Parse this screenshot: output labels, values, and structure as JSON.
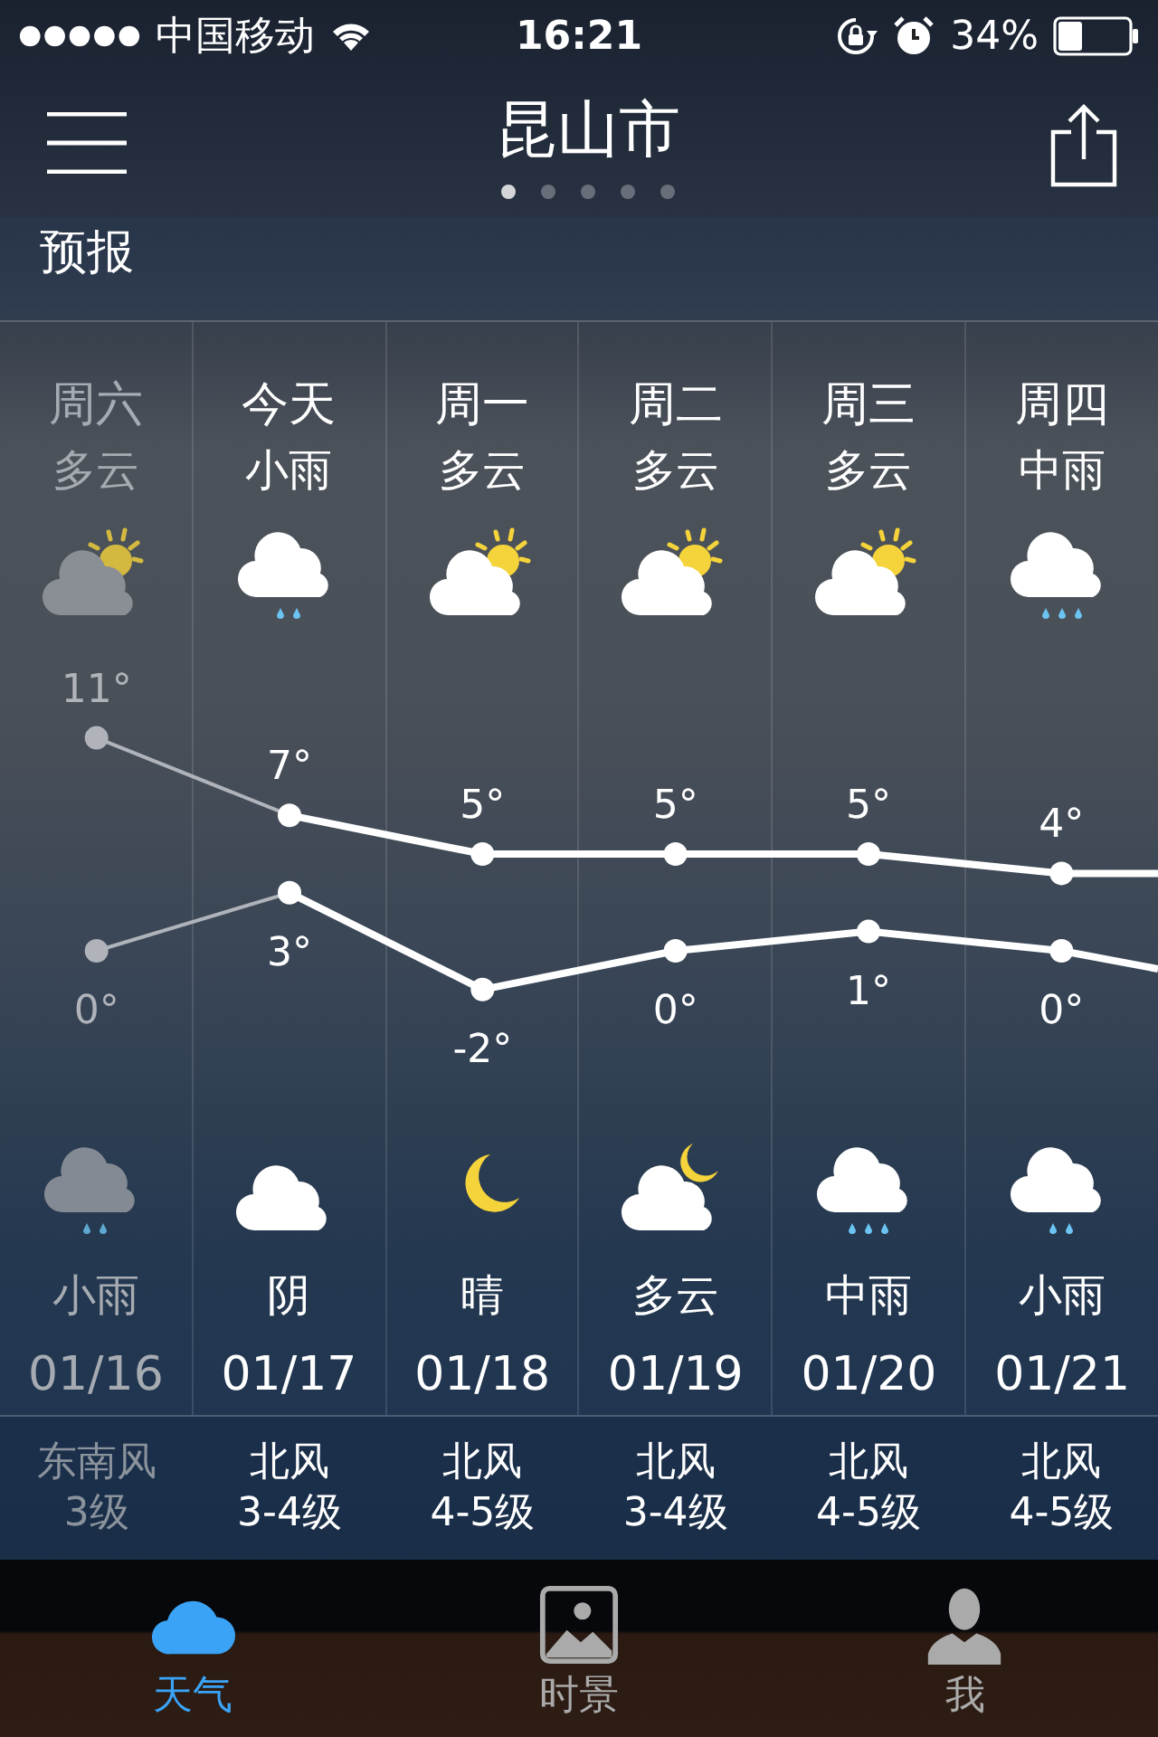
{
  "status_bar": {
    "carrier": "中国移动",
    "time": "16:21",
    "battery": "34%"
  },
  "nav": {
    "title": "昆山市",
    "pages": [
      {
        "selected": true
      },
      {
        "selected": false
      },
      {
        "selected": false
      },
      {
        "selected": false
      },
      {
        "selected": false
      }
    ]
  },
  "section_title": "预报",
  "days": [
    {
      "weekday": "周六",
      "day_condition": "多云",
      "day_icon": {
        "kind": "partly-cloudy"
      },
      "high": "11°",
      "low": "0°",
      "night_icon": {
        "kind": "light-rain"
      },
      "night_condition": "小雨",
      "date": "01/16",
      "wind_dir": "东南风",
      "wind_level": "3级",
      "past": true
    },
    {
      "weekday": "今天",
      "day_condition": "小雨",
      "day_icon": {
        "kind": "light-rain"
      },
      "high": "7°",
      "low": "3°",
      "night_icon": {
        "kind": "overcast"
      },
      "night_condition": "阴",
      "date": "01/17",
      "wind_dir": "北风",
      "wind_level": "3-4级",
      "past": false
    },
    {
      "weekday": "周一",
      "day_condition": "多云",
      "day_icon": {
        "kind": "partly-cloudy"
      },
      "high": "5°",
      "low": "-2°",
      "night_icon": {
        "kind": "clear-night"
      },
      "night_condition": "晴",
      "date": "01/18",
      "wind_dir": "北风",
      "wind_level": "4-5级",
      "past": false
    },
    {
      "weekday": "周二",
      "day_condition": "多云",
      "day_icon": {
        "kind": "partly-cloudy"
      },
      "high": "5°",
      "low": "0°",
      "night_icon": {
        "kind": "partly-cloudy-night"
      },
      "night_condition": "多云",
      "date": "01/19",
      "wind_dir": "北风",
      "wind_level": "3-4级",
      "past": false
    },
    {
      "weekday": "周三",
      "day_condition": "多云",
      "day_icon": {
        "kind": "partly-cloudy"
      },
      "high": "5°",
      "low": "1°",
      "night_icon": {
        "kind": "moderate-rain"
      },
      "night_condition": "中雨",
      "date": "01/20",
      "wind_dir": "北风",
      "wind_level": "4-5级",
      "past": false
    },
    {
      "weekday": "周四",
      "day_condition": "中雨",
      "day_icon": {
        "kind": "moderate-rain"
      },
      "high": "4°",
      "low": "0°",
      "night_icon": {
        "kind": "light-rain"
      },
      "night_condition": "小雨",
      "date": "01/21",
      "wind_dir": "北风",
      "wind_level": "4-5级",
      "past": false
    }
  ],
  "tabs": [
    {
      "label": "天气",
      "kind": "weather",
      "selected": true
    },
    {
      "label": "时景",
      "kind": "photo",
      "selected": false
    },
    {
      "label": "我",
      "kind": "profile",
      "selected": false
    }
  ]
}
